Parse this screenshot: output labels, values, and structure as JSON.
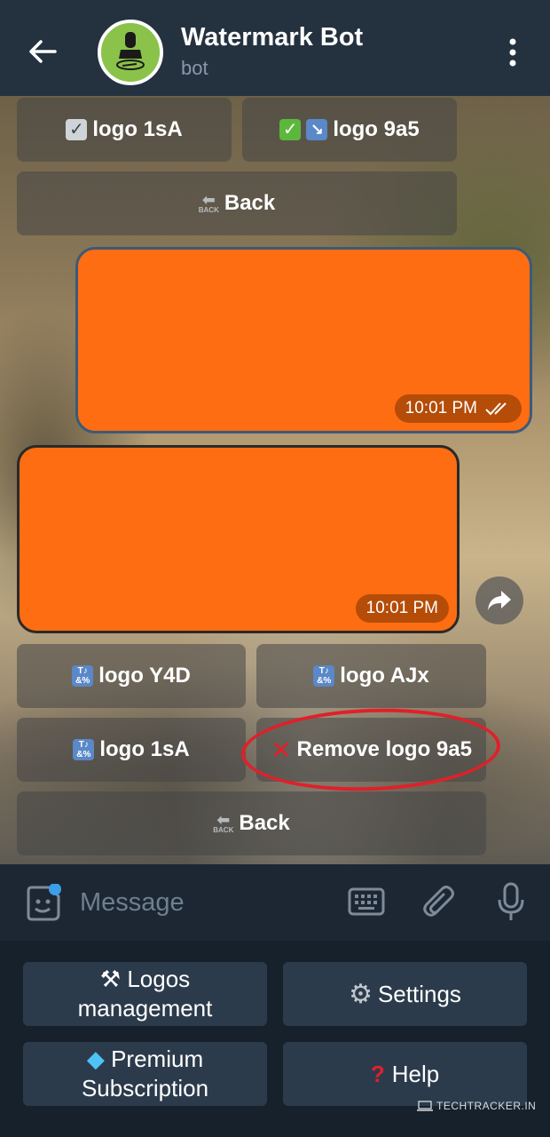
{
  "header": {
    "title": "Watermark Bot",
    "subtitle": "bot"
  },
  "inline_keyboard_top": {
    "row1": [
      {
        "label": "logo 1sA",
        "icon": "checkbox-grey-icon"
      },
      {
        "label": "logo 9a5",
        "icon": "checkbox-green-icon"
      }
    ],
    "back_label": "Back"
  },
  "messages": [
    {
      "direction": "out",
      "time": "10:01 PM",
      "read_status": "double-check",
      "color": "#ff6d12"
    },
    {
      "direction": "in",
      "time": "10:01 PM",
      "color": "#ff6d12"
    }
  ],
  "inline_keyboard_bottom": {
    "row1": [
      {
        "label": "logo Y4D"
      },
      {
        "label": "logo AJx"
      }
    ],
    "row2": [
      {
        "label": "logo 1sA"
      },
      {
        "label": "Remove logo 9a5"
      }
    ],
    "back_label": "Back"
  },
  "composer": {
    "placeholder": "Message"
  },
  "reply_keyboard": [
    {
      "label": "Logos\nmanagement",
      "icon": "hammer-wrench-icon"
    },
    {
      "label": "Settings",
      "icon": "gear-icon"
    },
    {
      "label": "Premium\nSubscription",
      "icon": "gem-icon"
    },
    {
      "label": "Help",
      "icon": "question-mark-icon"
    }
  ],
  "watermark": "TECHTRACKER.IN",
  "colors": {
    "header_bg": "#24313f",
    "accent_orange": "#ff6d12",
    "keyboard_bg": "#17212b",
    "highlight_red": "#e0202a"
  }
}
